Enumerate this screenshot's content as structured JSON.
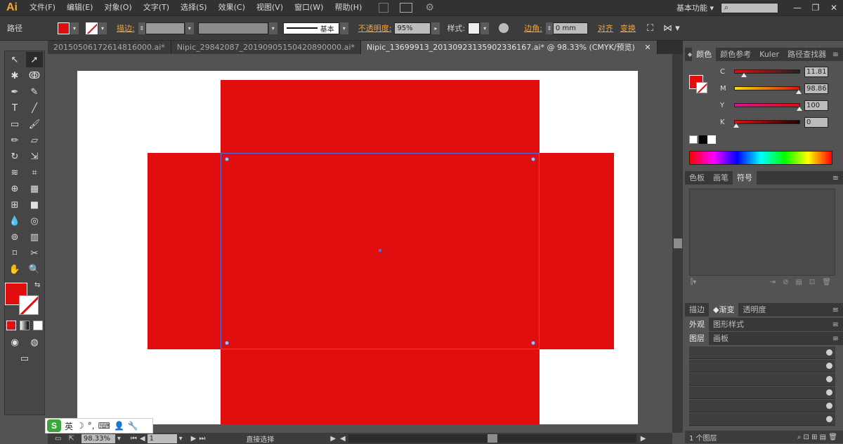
{
  "app": {
    "logo": "Ai"
  },
  "menu": [
    "文件(F)",
    "编辑(E)",
    "对象(O)",
    "文字(T)",
    "选择(S)",
    "效果(C)",
    "视图(V)",
    "窗口(W)",
    "帮助(H)"
  ],
  "menubar_right": {
    "workspace": "基本功能",
    "workspace_arrow": "▾"
  },
  "control": {
    "object_type": "路径",
    "stroke_label": "描边:",
    "stroke_style": "基本",
    "opacity_label": "不透明度:",
    "opacity_value": "95%",
    "style_label": "样式:",
    "corner_label": "边角:",
    "corner_value": "0 mm",
    "align_label": "对齐",
    "transform_label": "变换"
  },
  "tabs": [
    {
      "label": "20150506172614816000.ai*",
      "active": false
    },
    {
      "label": "Nipic_29842087_20190905150420890000.ai*",
      "active": false
    },
    {
      "label": "Nipic_13699913_20130923135902336167.ai* @ 98.33% (CMYK/预览)",
      "active": true
    }
  ],
  "colors": {
    "fill": "#e00e0e",
    "accent": "#f0a13c",
    "selection": "#5a6cd8"
  },
  "color_panel": {
    "tabs": [
      "颜色",
      "颜色参考",
      "Kuler",
      "路径查找器"
    ],
    "sliders": [
      {
        "letter": "C",
        "value": "11.81",
        "thumb": 0.12
      },
      {
        "letter": "M",
        "value": "98.86",
        "thumb": 0.99
      },
      {
        "letter": "Y",
        "value": "100",
        "thumb": 1.0
      },
      {
        "letter": "K",
        "value": "0",
        "thumb": 0.0
      }
    ]
  },
  "swatch_panel": {
    "tabs": [
      "色板",
      "画笔",
      "符号"
    ]
  },
  "stroke_panel": {
    "tabs": [
      "描边",
      "渐变",
      "透明度"
    ]
  },
  "appearance_panel": {
    "tabs": [
      "外观",
      "图形样式"
    ]
  },
  "layers_panel": {
    "tabs": [
      "图层",
      "画板"
    ],
    "footer": "1 个图层"
  },
  "status": {
    "zoom": "98.33%",
    "artboard": "1",
    "tool": "直接选择"
  },
  "ime": {
    "lang": "英"
  }
}
